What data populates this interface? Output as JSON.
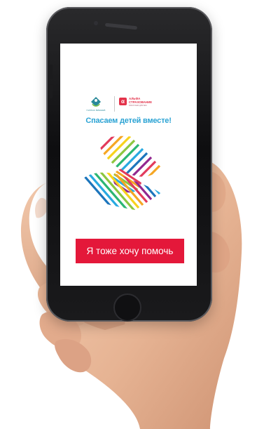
{
  "screen": {
    "logos": {
      "left_partner_text": "ГАЛИНА ВИШНЕВ",
      "right_partner_mark": "α",
      "right_partner_name": "АЛЬФА\nСТРАХОВАНИЕ",
      "right_partner_tagline": "РАБОТАЕМ ДЛЯ ВАС"
    },
    "slogan": "Спасаем детей вместе!",
    "cta_button_label": "Я тоже хочу помочь"
  },
  "colors": {
    "accent_red": "#e4183a",
    "slogan_blue": "#2ba3d4",
    "phone_black": "#111113",
    "skin": "#e9b99a"
  },
  "icons": {
    "phone": "smartphone-icon",
    "hand": "hand-holding-phone"
  }
}
